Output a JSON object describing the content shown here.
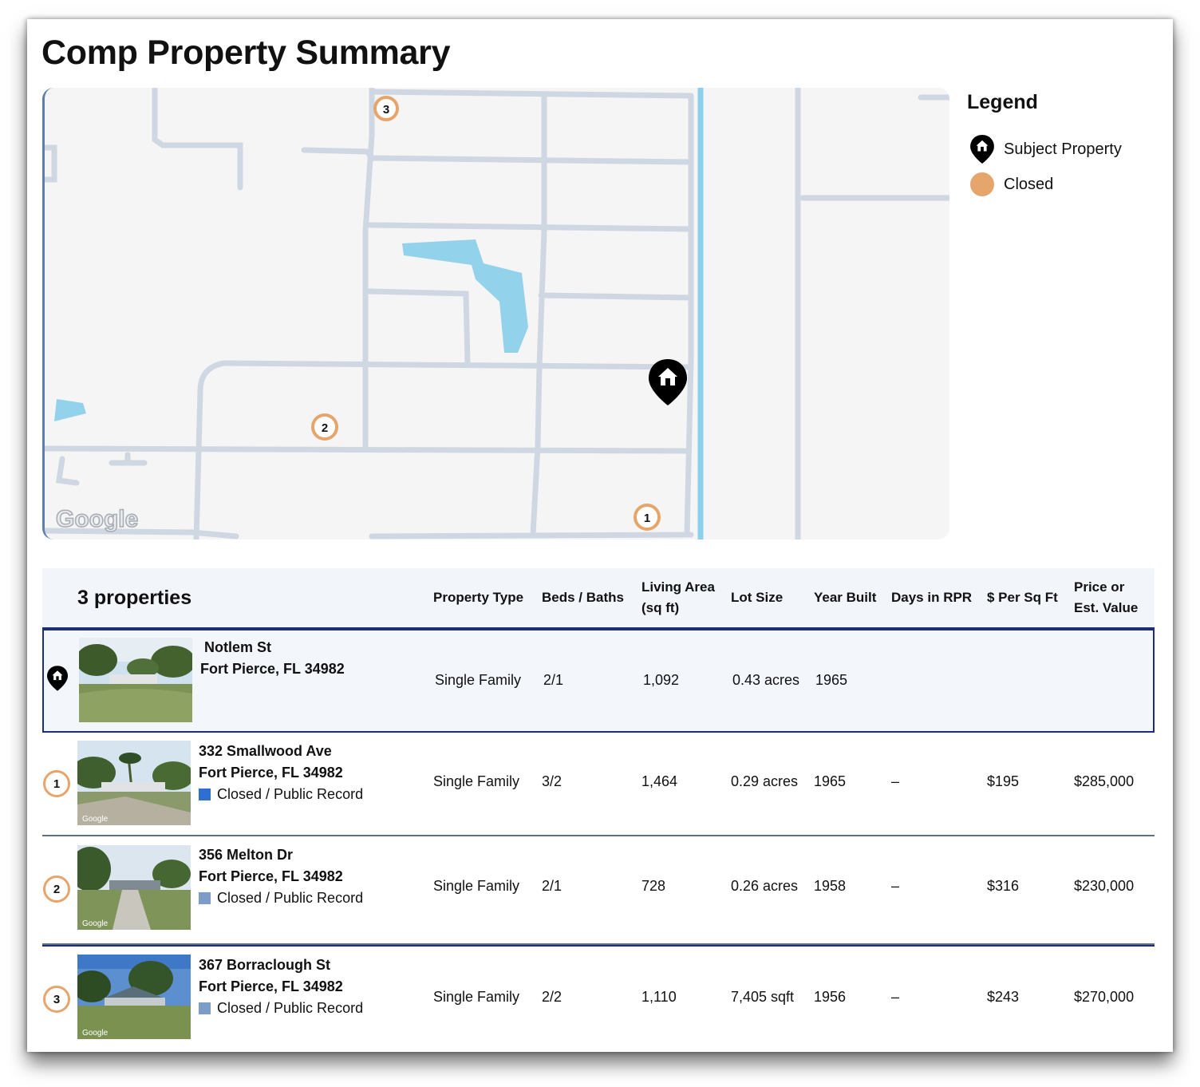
{
  "page": {
    "title": "Comp Property Summary"
  },
  "map": {
    "attribution": "Google",
    "markers": [
      "1",
      "2",
      "3"
    ]
  },
  "legend": {
    "title": "Legend",
    "items": [
      {
        "label": "Subject Property",
        "icon": "subject-pin-icon"
      },
      {
        "label": "Closed",
        "icon": "closed-dot-icon",
        "color": "#e6a56b"
      }
    ]
  },
  "table": {
    "count_label": "3 properties",
    "headers": {
      "type": "Property Type",
      "beds": "Beds / Baths",
      "area_1": "Living Area",
      "area_2": "(sq ft)",
      "lot": "Lot Size",
      "year": "Year Built",
      "days": "Days in RPR",
      "ppsf": "$ Per Sq Ft",
      "price_1": "Price or",
      "price_2": "Est. Value"
    },
    "subject": {
      "street": "Notlem St",
      "city": "Fort Pierce, FL 34982",
      "type": "Single Family",
      "beds": "2/1",
      "area": "1,092",
      "lot": "0.43 acres",
      "year": "1965"
    },
    "comps": [
      {
        "num": "1",
        "street": "332 Smallwood Ave",
        "city": "Fort Pierce, FL 34982",
        "status": "Closed / Public Record",
        "status_color": "#2f6fd1",
        "photo_credit": "Google",
        "type": "Single Family",
        "beds": "3/2",
        "area": "1,464",
        "lot": "0.29 acres",
        "year": "1965",
        "days": "–",
        "ppsf": "$195",
        "price": "$285,000"
      },
      {
        "num": "2",
        "street": "356 Melton Dr",
        "city": "Fort Pierce, FL 34982",
        "status": "Closed / Public Record",
        "status_color": "#7d9cc7",
        "photo_credit": "Google",
        "type": "Single Family",
        "beds": "2/1",
        "area": "728",
        "lot": "0.26 acres",
        "year": "1958",
        "days": "–",
        "ppsf": "$316",
        "price": "$230,000"
      },
      {
        "num": "3",
        "street": "367 Borraclough St",
        "city": "Fort Pierce, FL 34982",
        "status": "Closed / Public Record",
        "status_color": "#7d9cc7",
        "photo_credit": "Google",
        "type": "Single Family",
        "beds": "2/2",
        "area": "1,110",
        "lot": "7,405 sqft",
        "year": "1956",
        "days": "–",
        "ppsf": "$243",
        "price": "$270,000"
      }
    ]
  }
}
